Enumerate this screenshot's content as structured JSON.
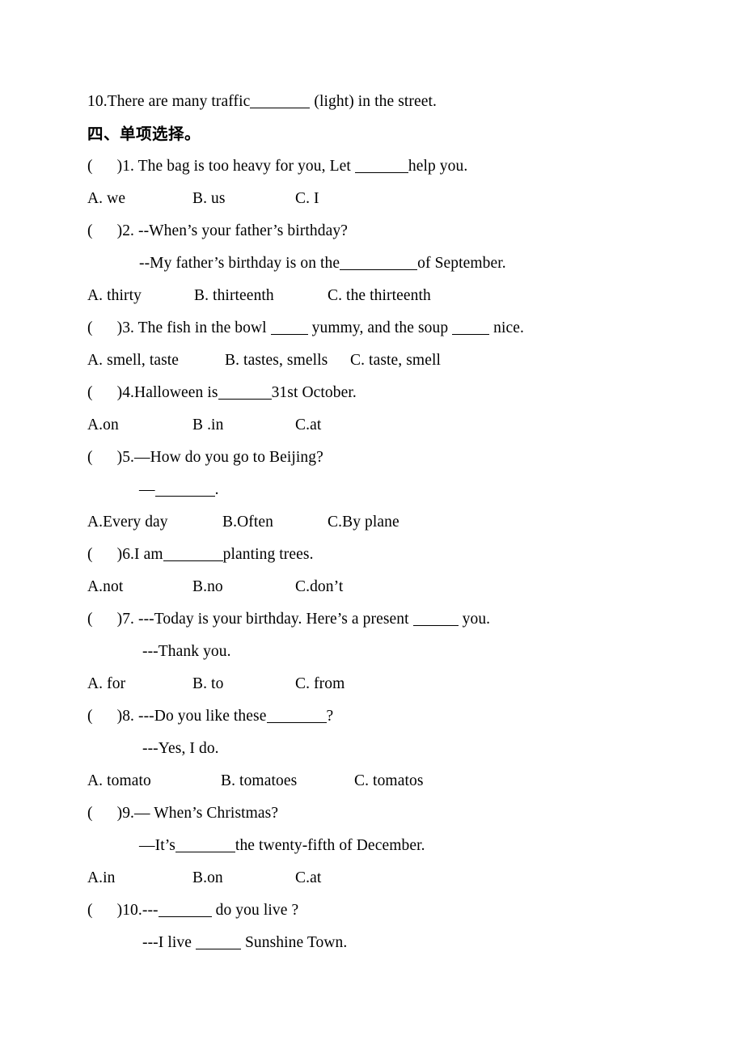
{
  "document": {
    "fill_in_last_item": {
      "number": "10.",
      "text_before": "There are many traffic",
      "text_after": " (light) in the street."
    },
    "section": {
      "heading": "四、单项选择。"
    },
    "questions": [
      {
        "marker_open": "(",
        "marker_close": ")",
        "number": "1.",
        "stem": " The bag is too heavy for you, Let ",
        "stem_after": "help you.",
        "options": [
          {
            "label": "A. we"
          },
          {
            "label": "B. us"
          },
          {
            "label": "C. I"
          }
        ],
        "option_positions": [
          0,
          130,
          257
        ]
      },
      {
        "marker_open": "(",
        "marker_close": ")",
        "number": "2.",
        "stem": " --When’s your father’s birthday?",
        "continuation_before": "--My father’s birthday is on the",
        "continuation_after": "of September.",
        "options": [
          {
            "label": "A. thirty"
          },
          {
            "label": "B. thirteenth"
          },
          {
            "label": "C. the thirteenth"
          }
        ],
        "option_positions": [
          0,
          132,
          297
        ]
      },
      {
        "marker_open": "(",
        "marker_close": ")",
        "number": "3.",
        "stem_a": " The fish in the bowl ",
        "stem_b": " yummy, and the soup ",
        "stem_c": " nice.",
        "options": [
          {
            "label": "A. smell, taste"
          },
          {
            "label": "B. tastes, smells"
          },
          {
            "label": "C. taste, smell"
          }
        ],
        "option_positions": [
          0,
          170,
          325
        ]
      },
      {
        "marker_open": "(",
        "marker_close": ")",
        "number": "4.",
        "stem": "Halloween is",
        "stem_after": "31st October.",
        "options": [
          {
            "label": "A.on"
          },
          {
            "label": "B .in"
          },
          {
            "label": "C.at"
          }
        ],
        "option_positions": [
          0,
          130,
          257
        ]
      },
      {
        "marker_open": "(",
        "marker_close": ")",
        "number": "5.",
        "stem": "—How do you go to Beijing?",
        "continuation_dash": "—",
        "continuation_after": ".",
        "options": [
          {
            "label": "A.Every day"
          },
          {
            "label": "B.Often"
          },
          {
            "label": "C.By plane"
          }
        ],
        "option_positions": [
          0,
          167,
          297
        ]
      },
      {
        "marker_open": "(",
        "marker_close": ")",
        "number": "6.",
        "stem": "I am",
        "stem_after": "planting trees.",
        "options": [
          {
            "label": "A.not"
          },
          {
            "label": "B.no"
          },
          {
            "label": "C.don’t"
          }
        ],
        "option_positions": [
          0,
          130,
          257
        ]
      },
      {
        "marker_open": "(",
        "marker_close": ")",
        "number": "7.",
        "stem": " ---Today is your birthday. Here’s a present ",
        "stem_after": " you.",
        "continuation": "---Thank you.",
        "options": [
          {
            "label": "A. for"
          },
          {
            "label": "B. to"
          },
          {
            "label": "C. from"
          }
        ],
        "option_positions": [
          0,
          130,
          257
        ]
      },
      {
        "marker_open": "(",
        "marker_close": ")",
        "number": "8.",
        "stem": " ---Do you like these",
        "stem_after": "?",
        "continuation": "---Yes, I do.",
        "options": [
          {
            "label": "A. tomato"
          },
          {
            "label": "B. tomatoes"
          },
          {
            "label": "C. tomatos"
          }
        ],
        "option_positions": [
          0,
          165,
          330
        ]
      },
      {
        "marker_open": "(",
        "marker_close": ")",
        "number": "9.",
        "stem": "— When’s Christmas?",
        "continuation_before": "—It’s",
        "continuation_after": "the twenty-fifth of December.",
        "options": [
          {
            "label": "A.in"
          },
          {
            "label": "B.on"
          },
          {
            "label": "C.at"
          }
        ],
        "option_positions": [
          0,
          130,
          257
        ]
      },
      {
        "marker_open": "(",
        "marker_close": ")",
        "number": "10.",
        "stem": "---",
        "stem_after": " do you live ?",
        "continuation_before": "---I live ",
        "continuation_after": " Sunshine Town."
      }
    ]
  }
}
